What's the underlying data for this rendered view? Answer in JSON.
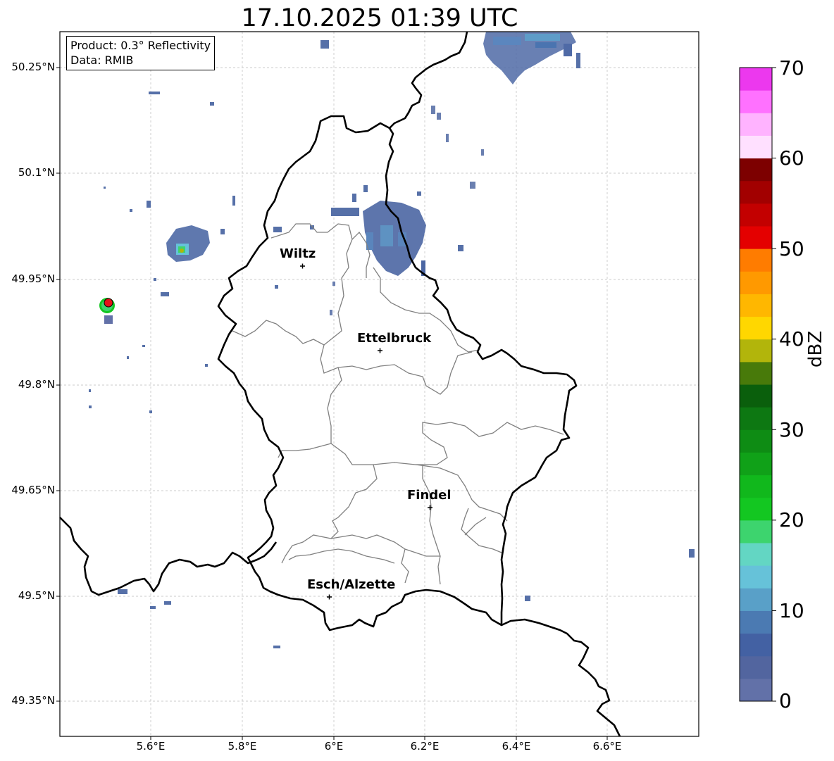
{
  "title": "17.10.2025 01:39 UTC",
  "info_box": {
    "product": "Product: 0.3° Reflectivity",
    "data_source": "Data: RMIB"
  },
  "lat_labels": [
    "50.25°N",
    "50.1°N",
    "49.95°N",
    "49.8°N",
    "49.65°N",
    "49.5°N",
    "49.35°N"
  ],
  "lon_labels": [
    "5.6°E",
    "5.8°E",
    "6°E",
    "6.2°E",
    "6.4°E",
    "6.6°E"
  ],
  "cities": {
    "wiltz": "Wiltz",
    "ettelbruck": "Ettelbruck",
    "findel": "Findel",
    "esch": "Esch/Alzette"
  },
  "colorbar": {
    "label": "dBZ",
    "ticks": [
      "0",
      "10",
      "20",
      "30",
      "40",
      "50",
      "60",
      "70"
    ],
    "colors": [
      "#6271a8",
      "#52659f",
      "#4361a3",
      "#4b7ab2",
      "#59a0c8",
      "#66c2d9",
      "#63d6c3",
      "#3dd46e",
      "#13c721",
      "#11b81c",
      "#10a118",
      "#0e8c14",
      "#0d7812",
      "#0a5f0c",
      "#487a0a",
      "#b2b50b",
      "#ffd700",
      "#ffb700",
      "#ff9900",
      "#ff7c00",
      "#e40000",
      "#c30000",
      "#a20000",
      "#7d0000",
      "#ffe0ff",
      "#ffb3ff",
      "#ff71ff",
      "#ec38ee"
    ]
  },
  "accent_colors": {
    "radar_site_marker": "#e4121a",
    "national_border": "#000000",
    "canton_border": "#808080",
    "grid": "#bbbbbb"
  }
}
